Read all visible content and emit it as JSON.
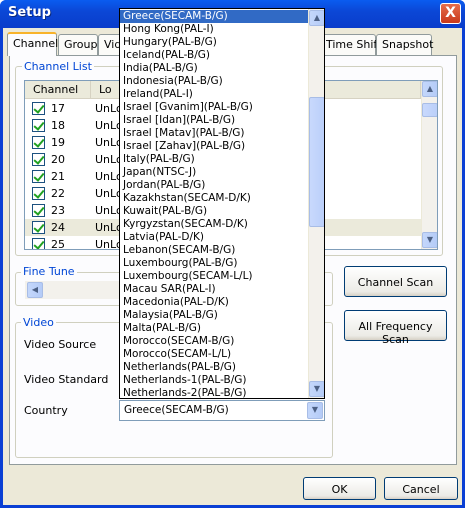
{
  "window": {
    "title": "Setup",
    "close": "X"
  },
  "tabs": [
    {
      "label": "Channel"
    },
    {
      "label": "Group"
    },
    {
      "label": "Vid"
    },
    {
      "label": "Time Shift"
    },
    {
      "label": "Snapshot"
    }
  ],
  "channel_list": {
    "group_label": "Channel List",
    "columns": [
      "Channel",
      "Lo"
    ],
    "rows": [
      {
        "num": "17",
        "name": "UnLo"
      },
      {
        "num": "18",
        "name": "UnLo"
      },
      {
        "num": "19",
        "name": "UnLo"
      },
      {
        "num": "20",
        "name": "UnLo"
      },
      {
        "num": "21",
        "name": "UnLo"
      },
      {
        "num": "22",
        "name": "UnLo"
      },
      {
        "num": "23",
        "name": "UnLo"
      },
      {
        "num": "24",
        "name": "UnLo"
      },
      {
        "num": "25",
        "name": "UnLo"
      }
    ]
  },
  "fine_tune": {
    "label": "Fine Tune"
  },
  "buttons": {
    "channel_scan": "Channel Scan",
    "all_frequency_scan": "All Frequency Scan",
    "ok": "OK",
    "cancel": "Cancel"
  },
  "video": {
    "group_label": "Video",
    "video_source": "Video Source",
    "video_standard": "Video Standard",
    "country_label": "Country",
    "country_value": "Greece(SECAM-B/G)"
  },
  "country_dropdown": {
    "selected": "Greece(SECAM-B/G)",
    "items": [
      "Greece(SECAM-B/G)",
      "Hong Kong(PAL-I)",
      "Hungary(PAL-B/G)",
      "Iceland(PAL-B/G)",
      "India(PAL-B/G)",
      "Indonesia(PAL-B/G)",
      "Ireland(PAL-I)",
      "Israel [Gvanim](PAL-B/G)",
      "Israel [Idan](PAL-B/G)",
      "Israel [Matav](PAL-B/G)",
      "Israel [Zahav](PAL-B/G)",
      "Italy(PAL-B/G)",
      "Japan(NTSC-J)",
      "Jordan(PAL-B/G)",
      "Kazakhstan(SECAM-D/K)",
      "Kuwait(PAL-B/G)",
      "Kyrgyzstan(SECAM-D/K)",
      "Latvia(PAL-D/K)",
      "Lebanon(SECAM-B/G)",
      "Luxembourg(PAL-B/G)",
      "Luxembourg(SECAM-L/L)",
      "Macau SAR(PAL-I)",
      "Macedonia(PAL-D/K)",
      "Malaysia(PAL-B/G)",
      "Malta(PAL-B/G)",
      "Morocco(SECAM-B/G)",
      "Morocco(SECAM-L/L)",
      "Netherlands(PAL-B/G)",
      "Netherlands-1(PAL-B/G)",
      "Netherlands-2(PAL-B/G)"
    ]
  },
  "icons": {
    "scroll_up": "▲",
    "scroll_down": "▼",
    "scroll_left": "◀",
    "chevron": "▾"
  }
}
